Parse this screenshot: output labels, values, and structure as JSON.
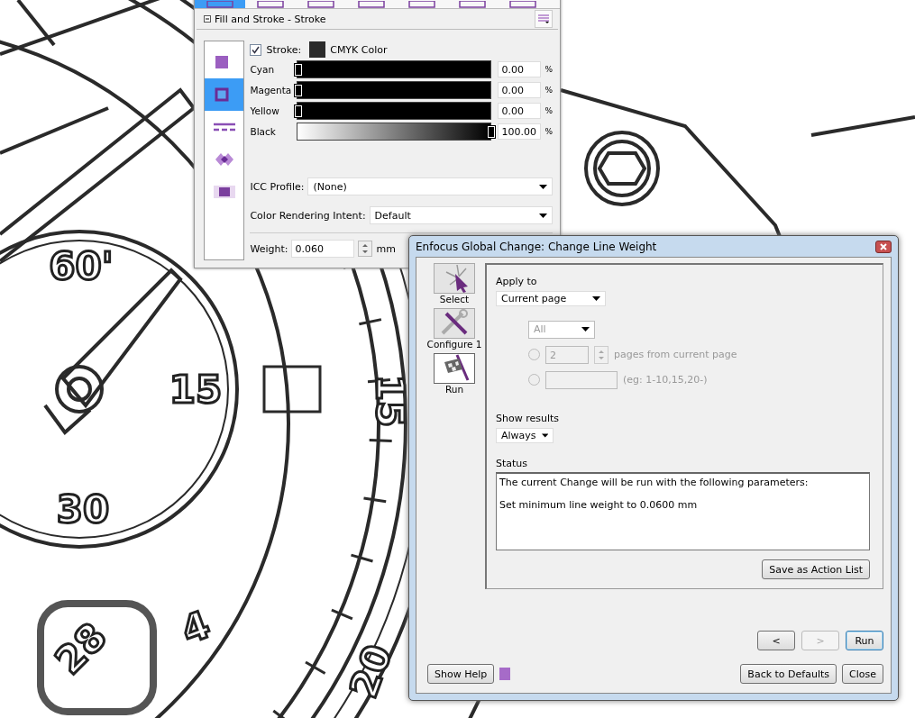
{
  "canvas": {
    "labels": [
      {
        "text": "60'"
      },
      {
        "text": "15"
      },
      {
        "text": "30"
      },
      {
        "text": "15"
      },
      {
        "text": "20"
      },
      {
        "text": "4"
      },
      {
        "text": "28"
      }
    ]
  },
  "panel": {
    "toolbar_tabs": [
      {
        "selected": true
      },
      {
        "selected": false
      },
      {
        "selected": false
      },
      {
        "selected": false
      },
      {
        "selected": false
      },
      {
        "selected": false
      },
      {
        "selected": false
      }
    ],
    "title": "Fill and Stroke - Stroke",
    "categories": [
      {
        "kind": "fill",
        "selected": false
      },
      {
        "kind": "stroke",
        "selected": true
      },
      {
        "kind": "dash",
        "selected": false
      },
      {
        "kind": "overlap",
        "selected": false
      },
      {
        "kind": "transparency",
        "selected": false
      }
    ],
    "stroke": {
      "checked": true,
      "label": "Stroke:",
      "mode": "CMYK Color"
    },
    "channels": [
      {
        "name": "Cyan",
        "kind": "solid",
        "level": 0,
        "value": "0.00",
        "unit": "%"
      },
      {
        "name": "Magenta",
        "kind": "solid",
        "level": 0,
        "value": "0.00",
        "unit": "%"
      },
      {
        "name": "Yellow",
        "kind": "solid",
        "level": 0,
        "value": "0.00",
        "unit": "%"
      },
      {
        "name": "Black",
        "kind": "gradient",
        "level": 1,
        "value": "100.00",
        "unit": "%"
      }
    ],
    "icc_profile": {
      "label": "ICC Profile:",
      "value": "(None)"
    },
    "rendering_intent": {
      "label": "Color Rendering Intent:",
      "value": "Default"
    },
    "weight": {
      "label": "Weight:",
      "value": "0.060",
      "unit": "mm"
    }
  },
  "dialog": {
    "title": "Enfocus Global Change: Change Line Weight",
    "steps": [
      {
        "kind": "select",
        "label": "Select",
        "selected": false
      },
      {
        "kind": "configure",
        "label": "Configure 1",
        "selected": false
      },
      {
        "kind": "run",
        "label": "Run",
        "selected": true
      }
    ],
    "apply_to": {
      "label": "Apply to",
      "value": "Current page"
    },
    "page_scope": {
      "value": "All",
      "disabled": true
    },
    "ranges": [
      {
        "kind": "spin",
        "selected": false,
        "disabled": true,
        "value": "2",
        "suffix": "pages from current page"
      },
      {
        "kind": "text",
        "selected": false,
        "disabled": true,
        "suffix": "(eg: 1-10,15,20-)"
      }
    ],
    "show_results": {
      "label": "Show results",
      "value": "Always"
    },
    "status": {
      "label": "Status",
      "lines": [
        "The current Change will be run with the following parameters:",
        "Set minimum line weight to 0.0600 mm"
      ]
    },
    "save_button": "Save as Action List",
    "nav_buttons": [
      {
        "label": "<",
        "disabled": false,
        "focused": false
      },
      {
        "label": ">",
        "disabled": true,
        "focused": false
      },
      {
        "label": "Run",
        "disabled": false,
        "focused": true
      }
    ],
    "help_button": "Show Help",
    "footer_buttons": [
      "Back to Defaults",
      "Close"
    ]
  }
}
